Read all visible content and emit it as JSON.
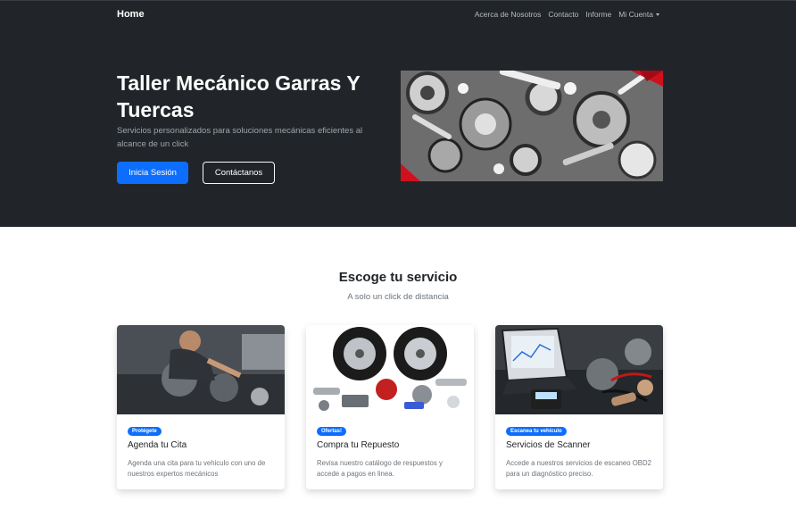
{
  "navbar": {
    "brand": "Home",
    "links": [
      "Acerca de Nosotros",
      "Contacto",
      "Informe",
      "Mi Cuenta"
    ]
  },
  "hero": {
    "title": "Taller Mecánico Garras Y Tuercas",
    "subtitle": "Servicios personalizados para soluciones mecánicas eficientes al alcance de un click",
    "primary_button": "Inicia Sesión",
    "secondary_button": "Contáctanos"
  },
  "services": {
    "title": "Escoge tu servicio",
    "subtitle": "A solo un click de distancia",
    "cards": [
      {
        "badge": "Protégete",
        "title": "Agenda tu Cita",
        "text": "Agenda una cita para tu vehiculo con uno de nuestros expertos mecánicos"
      },
      {
        "badge": "Ofertas!",
        "title": "Compra tu Repuesto",
        "text": "Revisa nuestro catálogo de respuestos y accede a pagos en linea."
      },
      {
        "badge": "Escanea tu vehículo",
        "title": "Servicios de Scanner",
        "text": "Accede a nuestros servicios de escaneo OBD2 para un diagnóstico preciso."
      }
    ]
  },
  "colors": {
    "dark_bg": "#212529",
    "primary": "#0d6efd"
  }
}
